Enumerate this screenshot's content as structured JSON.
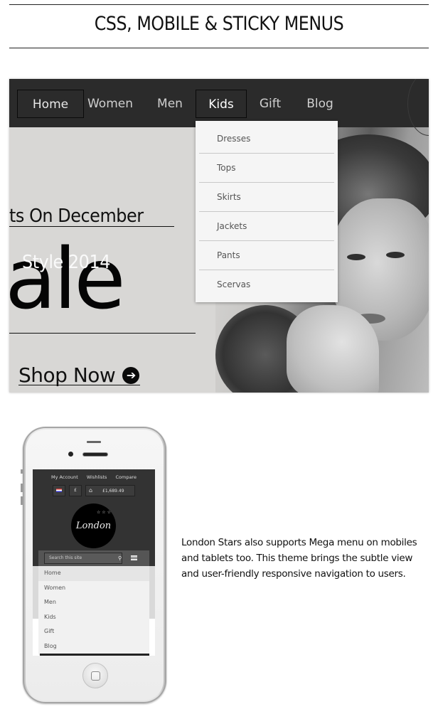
{
  "header": {
    "title": "CSS, MOBILE & STICKY MENUS"
  },
  "banner": {
    "nav": {
      "items": [
        {
          "label": "Home",
          "boxed": true
        },
        {
          "label": "Women",
          "boxed": false
        },
        {
          "label": "Men",
          "boxed": false
        },
        {
          "label": "Kids",
          "boxed": true,
          "active": true
        },
        {
          "label": "Gift",
          "boxed": false
        },
        {
          "label": "Blog",
          "boxed": false
        }
      ]
    },
    "dropdown": {
      "parent": "Kids",
      "items": [
        "Dresses",
        "Tops",
        "Skirts",
        "Jackets",
        "Pants",
        "Scervas"
      ]
    },
    "promo": {
      "line1": "ts On December",
      "style_text": "Style 2014",
      "sale_text": "ale",
      "cta_label": "Shop Now",
      "cta_icon": "arrow-circle-right-icon"
    }
  },
  "phone": {
    "top_links": [
      "My Account",
      "Wishlists",
      "Compare"
    ],
    "currency_symbol": "£",
    "cart_total": "£1,689.49",
    "logo_text": "London",
    "logo_stars": "☆ ☆ ☆",
    "search_placeholder": "Search this site",
    "menu_items": [
      "Home",
      "Women",
      "Men",
      "Kids",
      "Gift",
      "Blog"
    ]
  },
  "description": "London Stars  also supports Mega menu on mobiles and tablets too. This theme brings the subtle view and user-friendly responsive navigation to users.",
  "colors": {
    "nav_bg": "#2b2b2b",
    "dropdown_bg": "#f5f5f5",
    "banner_bg": "#d8d7d5"
  }
}
